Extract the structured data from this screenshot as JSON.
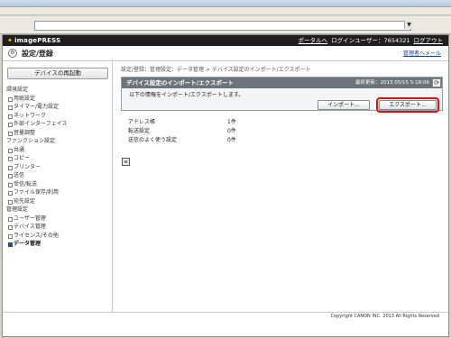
{
  "browser": {
    "address_value": "",
    "dropdown_glyph": "▼"
  },
  "header": {
    "brand": "imagePRESS",
    "portal_link": "ポータルへ",
    "login_user": "ログインユーザー：7654321",
    "logout_link": "ログアウト"
  },
  "titlebar": {
    "title": "設定/登録",
    "admin_link": "管理者へメール"
  },
  "sidebar": {
    "restart_button": "デバイスの再起動",
    "sections": [
      {
        "heading": "環境設定",
        "items": [
          "用紙設定",
          "タイマー/電力設定",
          "ネットワーク",
          "外部インターフェイス",
          "音量調整"
        ]
      },
      {
        "heading": "ファンクション設定",
        "items": [
          "共通",
          "コピー",
          "プリンター",
          "送信",
          "受信/転送",
          "ファイル保存/利用"
        ]
      },
      {
        "heading": "",
        "items": [
          "宛先設定"
        ]
      },
      {
        "heading": "管理設定",
        "items": [
          "ユーザー管理",
          "デバイス管理",
          "ライセンス/その他",
          "データ管理"
        ]
      }
    ],
    "active_item": "データ管理"
  },
  "content": {
    "breadcrumb": "設定/登録：管理設定：データ管理 > デバイス設定のインポート/エクスポート",
    "panel": {
      "title": "デバイス設定のインポート/エクスポート",
      "last_updated": "最終更新：2013 05/15 5:18:06",
      "description": "以下の情報をインポート/エクスポートします。",
      "import_button": "インポート...",
      "export_button": "エクスポート..."
    },
    "summary": [
      {
        "label": "アドレス帳",
        "value": "1件"
      },
      {
        "label": "転送設定",
        "value": "0件"
      },
      {
        "label": "送信のよく使う設定",
        "value": "0件"
      }
    ]
  },
  "footer": {
    "copyright": "Copyright CANON INC. 2013 All Rights Reserved"
  },
  "colors": {
    "header_bg": "#1f1f1f",
    "panel_header_bg": "#6d737b",
    "highlight": "#e01010",
    "active_bullet": "#1f4ea0"
  }
}
